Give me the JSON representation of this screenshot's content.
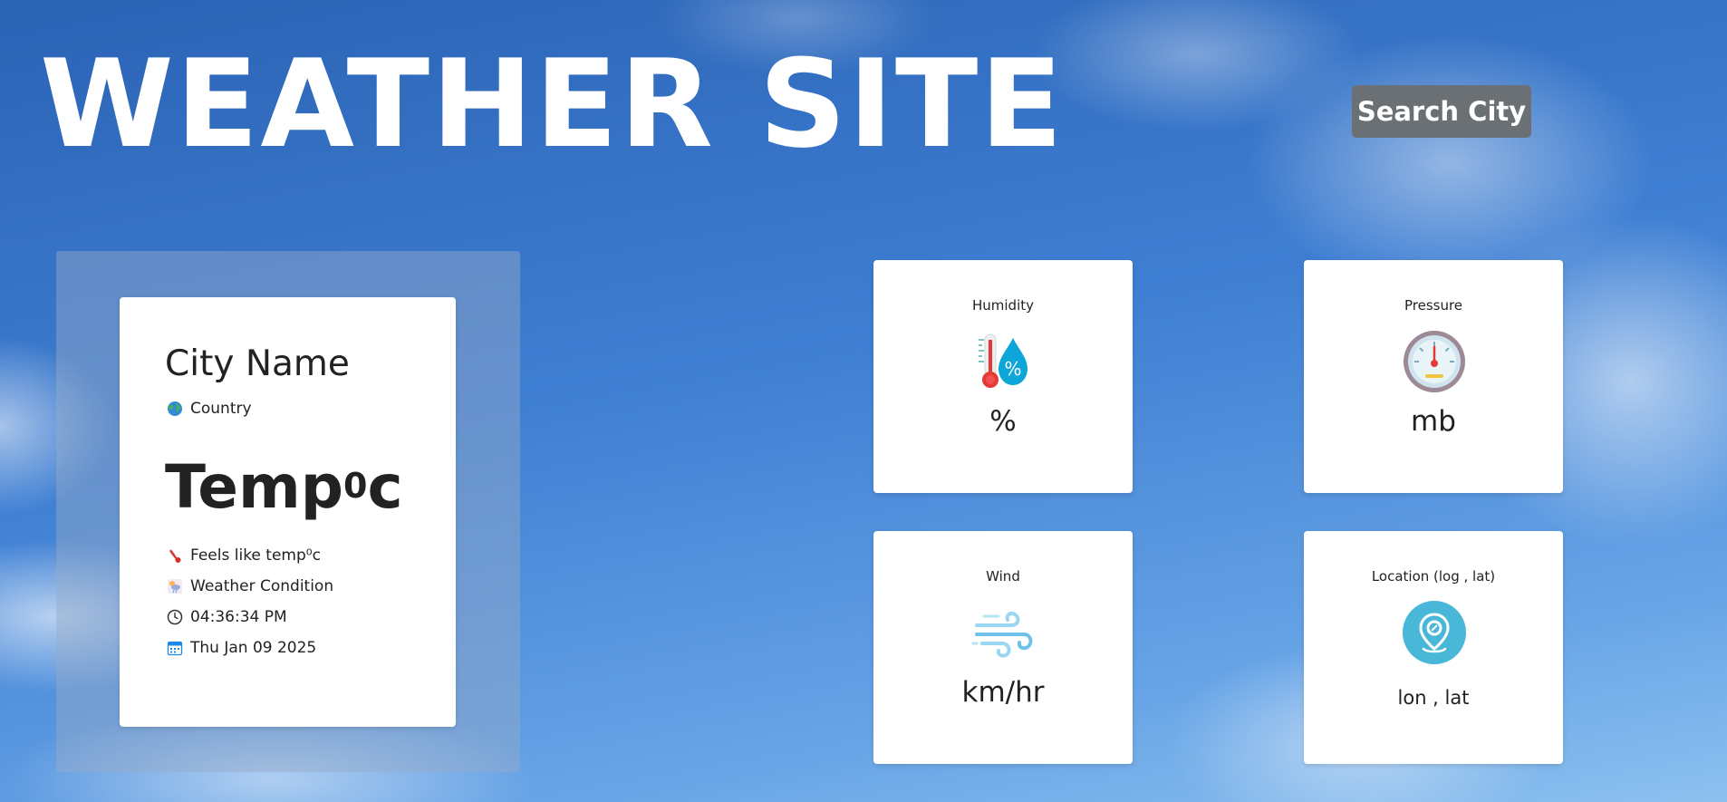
{
  "header": {
    "title": "WEATHER SITE",
    "search_label": "Search City"
  },
  "city_card": {
    "city_name": "City Name",
    "country": "Country",
    "temp": "Temp",
    "temp_unit_sup": "0",
    "temp_unit_letter": "c",
    "feels_like": "Feels like temp⁰c",
    "condition": "Weather Condition",
    "time": "04:36:34 PM",
    "date": "Thu Jan 09 2025",
    "icons": {
      "country": "globe-icon",
      "feels_like": "thermometer-icon",
      "condition": "weather-icon",
      "time": "clock-icon",
      "date": "calendar-icon"
    }
  },
  "stats": {
    "humidity": {
      "label": "Humidity",
      "value": "%",
      "icon": "humidity-icon"
    },
    "pressure": {
      "label": "Pressure",
      "value": "mb",
      "icon": "pressure-gauge-icon"
    },
    "wind": {
      "label": "Wind",
      "value": "km/hr",
      "icon": "wind-icon"
    },
    "location": {
      "label": "Location (log , lat)",
      "value": "lon , lat",
      "icon": "location-pin-icon"
    }
  },
  "colors": {
    "sky_top": "#2b63b5",
    "sky_bottom": "#8cc0ef",
    "button_bg": "#6b7075",
    "card_bg": "#ffffff",
    "text": "#222222"
  }
}
